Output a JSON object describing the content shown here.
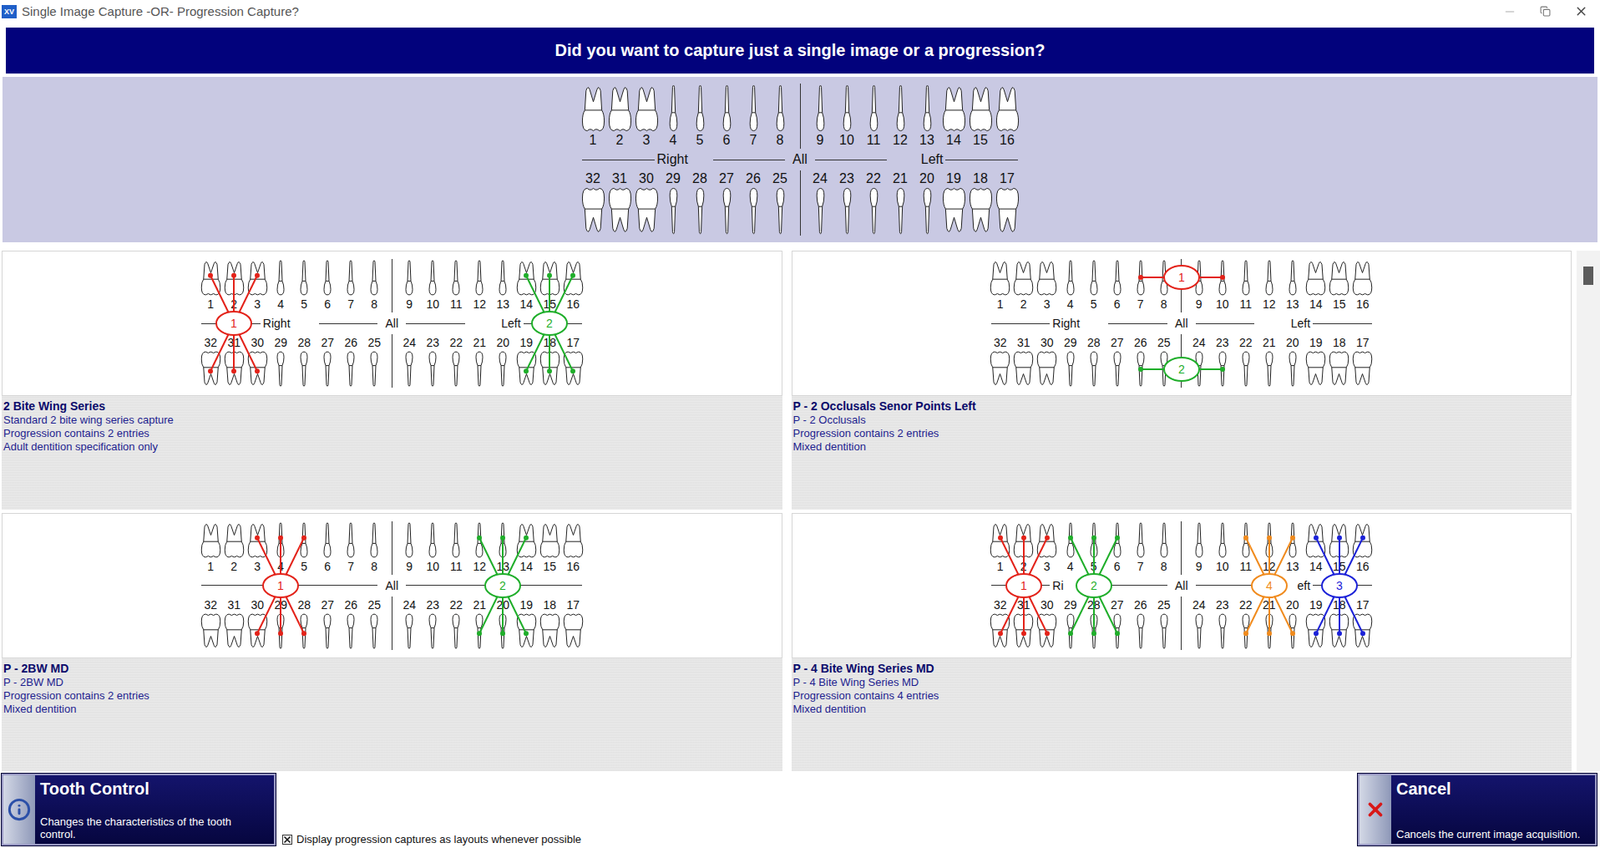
{
  "window": {
    "title": "Single Image Capture -OR- Progression Capture?",
    "icon": "XV"
  },
  "header": "Did you want to capture just a single image or a progression?",
  "chart": {
    "upper": [
      {
        "number": "1",
        "kind": "molar"
      },
      {
        "number": "2",
        "kind": "molar"
      },
      {
        "number": "3",
        "kind": "molar"
      },
      {
        "number": "4",
        "kind": "single"
      },
      {
        "number": "5",
        "kind": "single"
      },
      {
        "number": "6",
        "kind": "single"
      },
      {
        "number": "7",
        "kind": "single"
      },
      {
        "number": "8",
        "kind": "single"
      },
      {
        "number": "9",
        "kind": "single"
      },
      {
        "number": "10",
        "kind": "single"
      },
      {
        "number": "11",
        "kind": "single"
      },
      {
        "number": "12",
        "kind": "single"
      },
      {
        "number": "13",
        "kind": "single"
      },
      {
        "number": "14",
        "kind": "molar"
      },
      {
        "number": "15",
        "kind": "molar"
      },
      {
        "number": "16",
        "kind": "molar"
      }
    ],
    "lower": [
      {
        "number": "32",
        "kind": "molar"
      },
      {
        "number": "31",
        "kind": "molar"
      },
      {
        "number": "30",
        "kind": "molar"
      },
      {
        "number": "29",
        "kind": "single"
      },
      {
        "number": "28",
        "kind": "single"
      },
      {
        "number": "27",
        "kind": "single"
      },
      {
        "number": "26",
        "kind": "single"
      },
      {
        "number": "25",
        "kind": "single"
      },
      {
        "number": "24",
        "kind": "single"
      },
      {
        "number": "23",
        "kind": "single"
      },
      {
        "number": "22",
        "kind": "single"
      },
      {
        "number": "21",
        "kind": "single"
      },
      {
        "number": "20",
        "kind": "single"
      },
      {
        "number": "19",
        "kind": "molar"
      },
      {
        "number": "18",
        "kind": "molar"
      },
      {
        "number": "17",
        "kind": "molar"
      }
    ],
    "labels": {
      "right": "Right",
      "all": "All",
      "left": "Left"
    }
  },
  "progressions": [
    {
      "title": "2 Bite Wing Series",
      "lines": [
        "Standard 2 bite wing series capture",
        "Progression contains 2 entries",
        "Adult dentition specification only"
      ],
      "labels": {
        "right": "Right",
        "all": "All",
        "left": "Left"
      },
      "markers": [
        {
          "label": "1",
          "color": "#e32219",
          "row": "both",
          "teeth": [
            "1",
            "2",
            "3",
            "32",
            "31",
            "30"
          ]
        },
        {
          "label": "2",
          "color": "#1fae2a",
          "row": "both",
          "teeth": [
            "14",
            "15",
            "16",
            "19",
            "18",
            "17"
          ]
        }
      ]
    },
    {
      "title": "P - 2 Occlusals Senor Points Left",
      "lines": [
        "P - 2 Occlusals",
        "Progression contains 2 entries",
        "Mixed dentition"
      ],
      "labels": {
        "right": "Right",
        "all": "All",
        "left": "Left"
      },
      "markers": [
        {
          "label": "1",
          "color": "#e32219",
          "row": "upper",
          "teeth": [
            "7",
            "10"
          ]
        },
        {
          "label": "2",
          "color": "#1fae2a",
          "row": "lower",
          "teeth": [
            "26",
            "23"
          ]
        }
      ]
    },
    {
      "title": "P - 2BW MD",
      "lines": [
        "P - 2BW MD",
        "Progression contains 2 entries",
        "Mixed dentition"
      ],
      "labels": {
        "right": "",
        "all": "All",
        "left": ""
      },
      "markers": [
        {
          "label": "1",
          "color": "#e32219",
          "row": "both",
          "teeth": [
            "3",
            "4",
            "5",
            "30",
            "29",
            "28"
          ]
        },
        {
          "label": "2",
          "color": "#1fae2a",
          "row": "both",
          "teeth": [
            "12",
            "13",
            "14",
            "21",
            "20",
            "19"
          ]
        }
      ]
    },
    {
      "title": "P - 4 Bite Wing Series MD",
      "lines": [
        "P - 4 Bite Wing Series MD",
        "Progression contains 4 entries",
        "Mixed dentition"
      ],
      "labels": {
        "right": "Ri",
        "all": "All",
        "left": "eft"
      },
      "markers": [
        {
          "label": "1",
          "color": "#e32219",
          "row": "both",
          "teeth": [
            "1",
            "2",
            "3",
            "32",
            "31",
            "30"
          ]
        },
        {
          "label": "2",
          "color": "#1fae2a",
          "row": "both",
          "teeth": [
            "4",
            "5",
            "6",
            "29",
            "28",
            "27"
          ]
        },
        {
          "label": "4",
          "color": "#f08a1c",
          "row": "both",
          "teeth": [
            "11",
            "12",
            "13",
            "22",
            "21",
            "20"
          ]
        },
        {
          "label": "3",
          "color": "#1c22d8",
          "row": "both",
          "teeth": [
            "14",
            "15",
            "16",
            "19",
            "18",
            "17"
          ]
        }
      ]
    }
  ],
  "scrollbar": {
    "level": 0.03
  },
  "buttons": [
    {
      "kind": "info",
      "title": "Tooth Control",
      "description": "Changes the characteristics of the tooth control."
    },
    {
      "kind": "cancel",
      "title": "Cancel",
      "description": "Cancels the current image acquisition."
    }
  ],
  "checkbox": {
    "label": "Display progression captures as layouts whenever possible",
    "checked": true
  }
}
